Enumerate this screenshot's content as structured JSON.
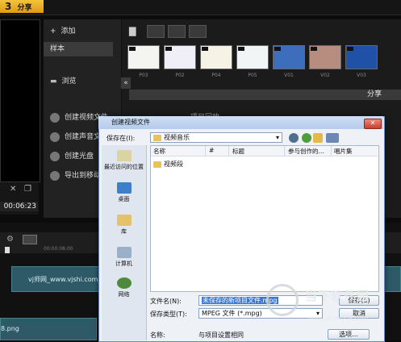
{
  "top": {
    "step_number": "3",
    "step_label": "分享"
  },
  "preview": {
    "timecode": "00:06:23"
  },
  "side_menu": {
    "add_label": "添加",
    "sample_label": "样本",
    "browse_label": "浏览",
    "collapse_glyph": "«"
  },
  "media": {
    "thumbs": [
      {
        "label": "P03",
        "color": "#f4f4f0"
      },
      {
        "label": "P02",
        "color": "#f0eef6"
      },
      {
        "label": "P04",
        "color": "#f6f3e6"
      },
      {
        "label": "P05",
        "color": "#f2f5f6"
      },
      {
        "label": "V01",
        "color": "#3d6ebc"
      },
      {
        "label": "V02",
        "color": "#b78d7f"
      },
      {
        "label": "V03",
        "color": "#1f52a6"
      },
      {
        "label": "",
        "color": "#2a6cc4"
      }
    ]
  },
  "share": {
    "bar_label": "分享",
    "options": [
      "创建视频文件",
      "创建声音文件",
      "创建光盘",
      "导出到移动"
    ],
    "partial_text": "项目回放"
  },
  "timeline": {
    "ruler_time": "00:00:08.00",
    "track1_text": "vj师网_www.vjshi.com_",
    "track2_text": "8.png"
  },
  "dialog": {
    "title": "创建视频文件",
    "save_in_label": "保存在(I):",
    "save_in_value": "视频音乐",
    "columns": [
      "名称",
      "#",
      "标题",
      "参与创作的...",
      "唱片集"
    ],
    "files": [
      {
        "name": "视频段"
      }
    ],
    "places": [
      "最近访问的位置",
      "桌面",
      "库",
      "计算机",
      "网络"
    ],
    "filename_label": "文件名(N):",
    "filename_value": "未保存的新项目文件.mpg",
    "filetype_label": "保存类型(T):",
    "filetype_value": "MPEG 文件 (*.mpg)",
    "name_label": "名称:",
    "name_value": "与项目设置相同",
    "save_button": "保存(S)",
    "cancel_button": "取消",
    "options_button": "选项..."
  },
  "watermark": {
    "text": "当下软件园",
    "url": "www.downxia.com"
  }
}
